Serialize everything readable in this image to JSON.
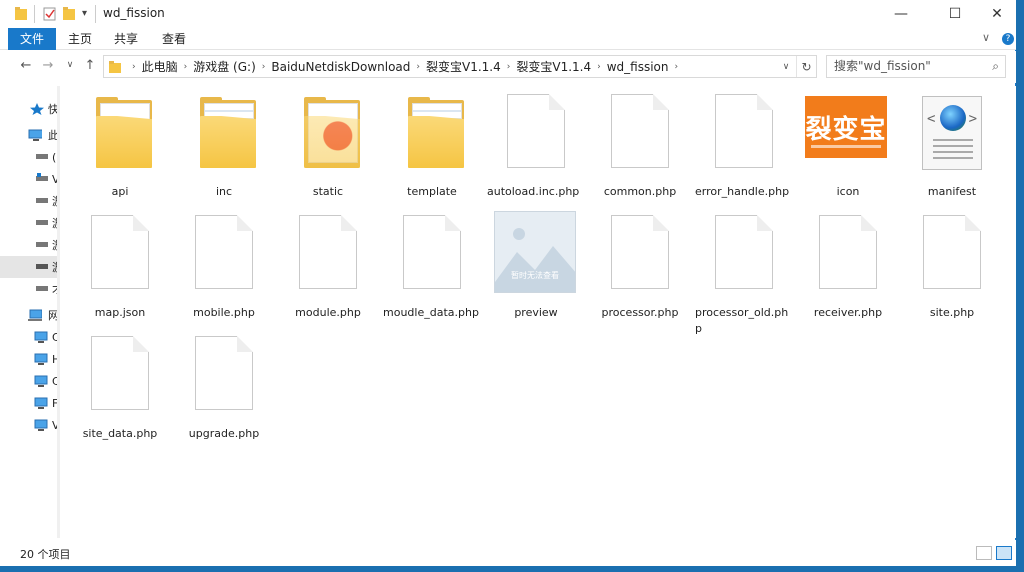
{
  "window": {
    "title": "wd_fission",
    "minimize": "—",
    "maximize": "☐",
    "close": "✕"
  },
  "ribbon": {
    "tabs": [
      "文件",
      "主页",
      "共享",
      "查看"
    ],
    "collapse": "∨",
    "help": "?"
  },
  "address": {
    "crumbs": [
      "此电脑",
      "游戏盘 (G:)",
      "BaiduNetdiskDownload",
      "裂变宝V1.1.4",
      "裂变宝V1.1.4",
      "wd_fission"
    ],
    "search_placeholder": "搜索\"wd_fission\""
  },
  "nav": {
    "items": [
      {
        "label": "快"
      },
      {
        "label": "此"
      },
      {
        "label": "("
      },
      {
        "label": "V"
      },
      {
        "label": "游"
      },
      {
        "label": "游"
      },
      {
        "label": "游"
      },
      {
        "label": "游"
      },
      {
        "label": "才"
      },
      {
        "label": "网"
      },
      {
        "label": "C"
      },
      {
        "label": "H"
      },
      {
        "label": "C"
      },
      {
        "label": "F"
      },
      {
        "label": "V"
      }
    ]
  },
  "files": [
    {
      "name": "api",
      "type": "folder"
    },
    {
      "name": "inc",
      "type": "folder"
    },
    {
      "name": "static",
      "type": "folder"
    },
    {
      "name": "template",
      "type": "folder"
    },
    {
      "name": "autoload.inc.php",
      "type": "file"
    },
    {
      "name": "common.php",
      "type": "file"
    },
    {
      "name": "error_handle.php",
      "type": "file"
    },
    {
      "name": "icon",
      "type": "image"
    },
    {
      "name": "manifest",
      "type": "manifest"
    },
    {
      "name": "map.json",
      "type": "file"
    },
    {
      "name": "mobile.php",
      "type": "file"
    },
    {
      "name": "module.php",
      "type": "file"
    },
    {
      "name": "moudle_data.php",
      "type": "file"
    },
    {
      "name": "preview",
      "type": "preview"
    },
    {
      "name": "processor.php",
      "type": "file"
    },
    {
      "name": "processor_old.php",
      "type": "file"
    },
    {
      "name": "receiver.php",
      "type": "file"
    },
    {
      "name": "site.php",
      "type": "file"
    },
    {
      "name": "site_data.php",
      "type": "file"
    },
    {
      "name": "upgrade.php",
      "type": "file"
    }
  ],
  "icon_text": "裂变宝",
  "preview_text": "暂时无法查看",
  "status": {
    "count": "20 个项目"
  },
  "colors": {
    "accent": "#1979ca",
    "folder": "#f5c543",
    "icon_orange": "#f27c1b"
  }
}
